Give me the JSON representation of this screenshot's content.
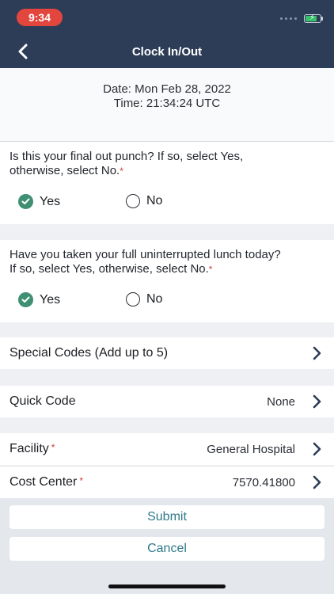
{
  "status_bar": {
    "time": "9:34"
  },
  "nav": {
    "title": "Clock In/Out"
  },
  "info": {
    "date": "Date: Mon Feb 28, 2022",
    "time": "Time: 21:34:24 UTC"
  },
  "questions": [
    {
      "text": "Is this your final out punch? If so, select Yes, otherwise, select No.",
      "required_mark": "*",
      "options": [
        "Yes",
        "No"
      ],
      "selected": "Yes"
    },
    {
      "text": "Have you taken your full uninterrupted lunch today? If so, select Yes, otherwise, select No.",
      "required_mark": "*",
      "options": [
        "Yes",
        "No"
      ],
      "selected": "Yes"
    }
  ],
  "rows": {
    "special_codes": {
      "label": "Special Codes (Add up to 5)"
    },
    "quick_code": {
      "label": "Quick Code",
      "value": "None"
    },
    "facility": {
      "label": "Facility",
      "required_mark": "*",
      "value": "General Hospital"
    },
    "cost_center": {
      "label": "Cost Center",
      "required_mark": "*",
      "value": "7570.41800"
    }
  },
  "buttons": {
    "submit": "Submit",
    "cancel": "Cancel"
  },
  "colors": {
    "header": "#2d3d57",
    "accent": "#3f8f73",
    "button_text": "#2f7a88",
    "required": "#d33c3c",
    "time_pill": "#e2463d"
  }
}
